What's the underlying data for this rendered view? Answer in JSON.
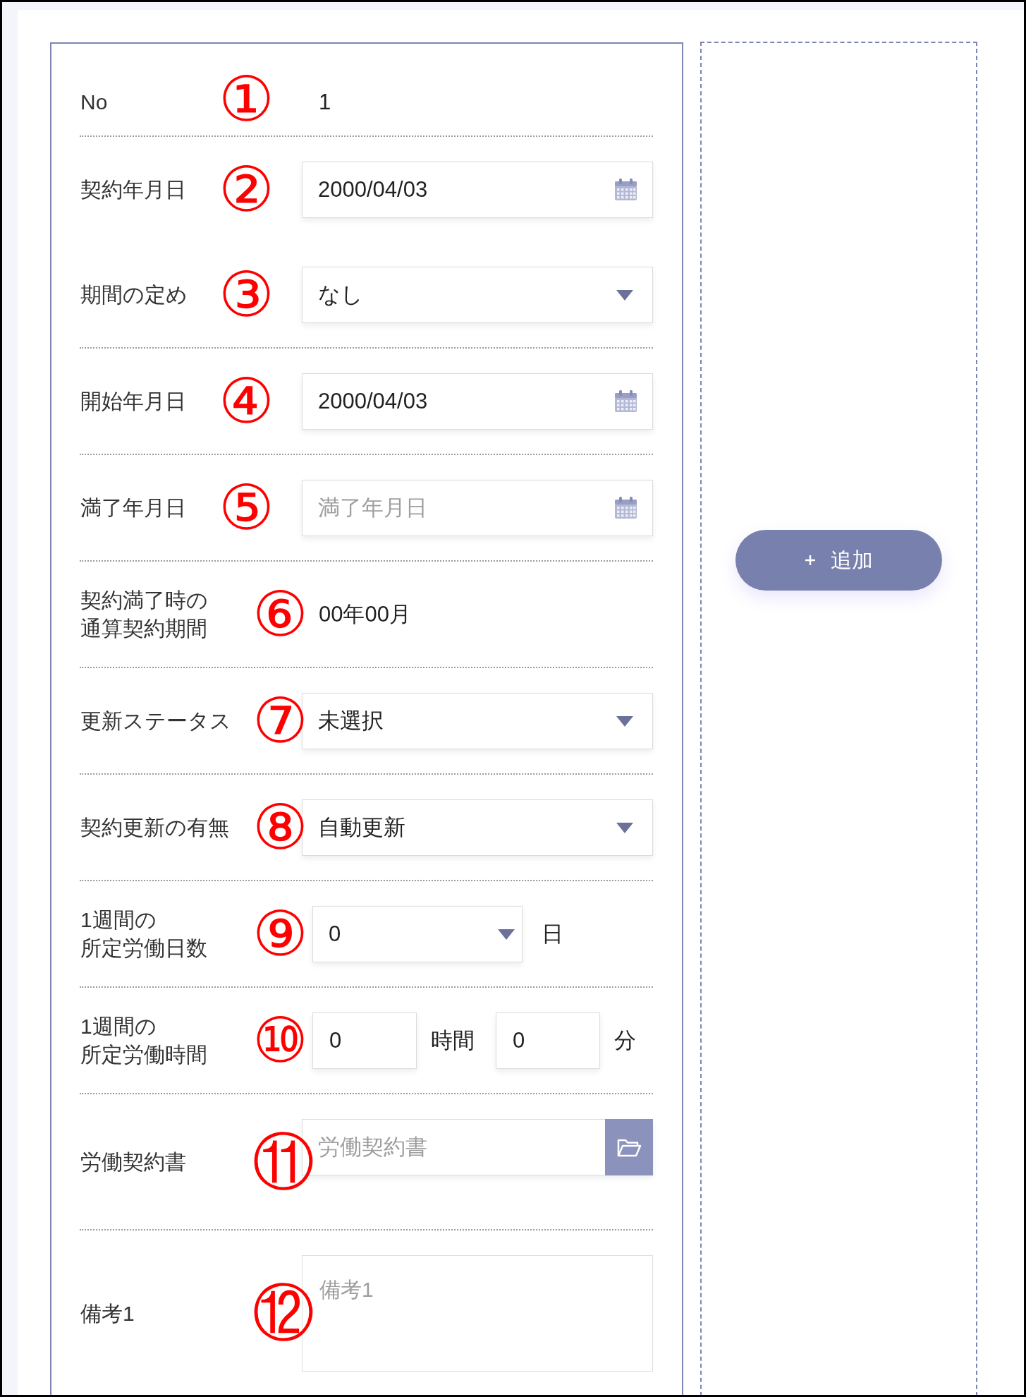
{
  "form": {
    "sections": [
      {
        "rows": [
          {
            "kind": "text",
            "label": "No",
            "marker": "①",
            "value": "1"
          }
        ]
      },
      {
        "rows": [
          {
            "kind": "date",
            "label": "契約年月日",
            "marker": "②",
            "value": "2000/04/03"
          },
          {
            "kind": "select",
            "label": "期間の定め",
            "marker": "③",
            "value": "なし"
          }
        ]
      },
      {
        "rows": [
          {
            "kind": "date",
            "label": "開始年月日",
            "marker": "④",
            "value": "2000/04/03"
          }
        ]
      },
      {
        "rows": [
          {
            "kind": "date",
            "label": "満了年月日",
            "marker": "⑤",
            "placeholder": "満了年月日"
          }
        ]
      },
      {
        "rows": [
          {
            "kind": "text",
            "label": "契約満了時の通算契約期間",
            "marker": "⑥",
            "value": "00年00月"
          }
        ]
      },
      {
        "rows": [
          {
            "kind": "select",
            "label": "更新ステータス",
            "marker": "⑦",
            "value": "未選択"
          }
        ]
      },
      {
        "rows": [
          {
            "kind": "select",
            "label": "契約更新の有無",
            "marker": "⑧",
            "value": "自動更新"
          }
        ]
      },
      {
        "rows": [
          {
            "kind": "select_unit",
            "label": "1週間の所定労働日数",
            "marker": "⑨",
            "value": "0",
            "unit": "日"
          }
        ]
      },
      {
        "rows": [
          {
            "kind": "duration",
            "label": "1週間の所定労働時間",
            "marker": "⑩",
            "parts": [
              {
                "value": "0",
                "unit": "時間"
              },
              {
                "value": "0",
                "unit": "分"
              }
            ]
          }
        ]
      },
      {
        "rows": [
          {
            "kind": "file",
            "label": "労働契約書",
            "marker": "⑪",
            "placeholder": "労働契約書"
          }
        ]
      },
      {
        "rows": [
          {
            "kind": "textarea",
            "label": "備考1",
            "marker": "⑫",
            "placeholder": "備考1"
          }
        ]
      }
    ]
  },
  "side_panel": {
    "add_button": {
      "label": "追加"
    }
  }
}
